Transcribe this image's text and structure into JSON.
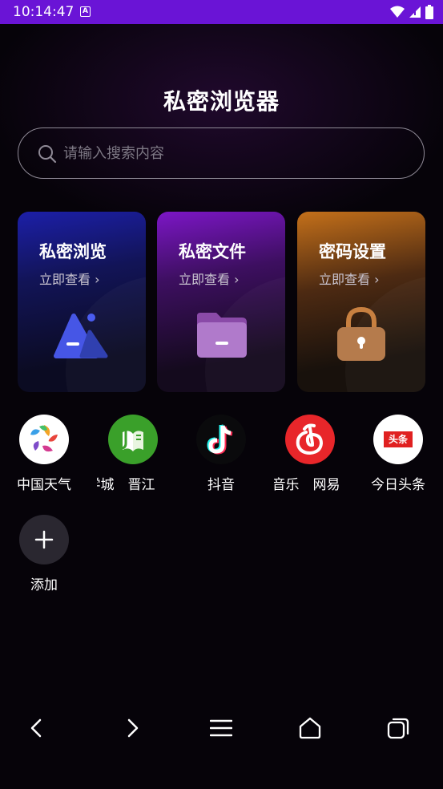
{
  "status_bar": {
    "time": "10:14:47",
    "notification_icon": "A"
  },
  "app": {
    "title": "私密浏览器"
  },
  "search": {
    "placeholder": "请输入搜索内容"
  },
  "cards": [
    {
      "title": "私密浏览",
      "link": "立即查看 ›",
      "icon": "image-icon",
      "accent": "#3b4ae0"
    },
    {
      "title": "私密文件",
      "link": "立即查看 ›",
      "icon": "folder-icon",
      "accent": "#8a2fd0"
    },
    {
      "title": "密码设置",
      "link": "立即查看 ›",
      "icon": "lock-icon",
      "accent": "#c88040"
    }
  ],
  "shortcuts": [
    {
      "label": "中国天气",
      "icon": "weather-icon"
    },
    {
      "label": "学城　晋江",
      "icon": "jinjiang-icon"
    },
    {
      "label": "抖音",
      "icon": "tiktok-icon"
    },
    {
      "label": "音乐　网易",
      "icon": "netease-music-icon"
    },
    {
      "label": "今日头条",
      "icon": "toutiao-icon"
    }
  ],
  "add": {
    "label": "添加"
  },
  "toutiao_badge": "头条",
  "nav": [
    "back",
    "forward",
    "menu",
    "home",
    "tabs"
  ]
}
